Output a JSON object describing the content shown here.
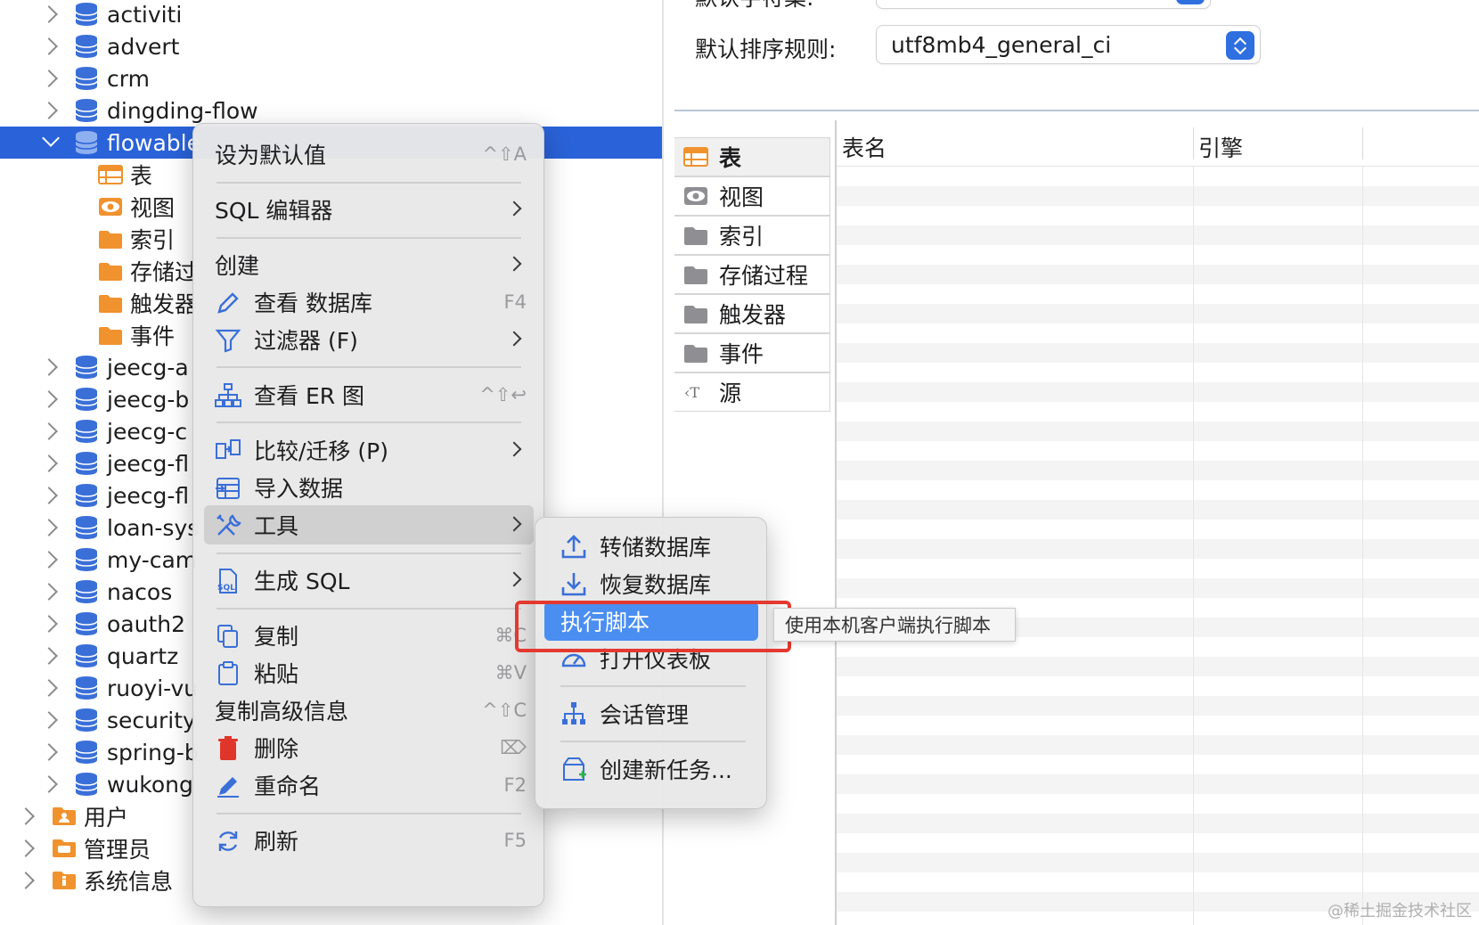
{
  "tree": {
    "databases_top": [
      "activiti",
      "advert",
      "crm",
      "dingding-flow"
    ],
    "selected": "flowable",
    "children": [
      "表",
      "视图",
      "索引",
      "存储过",
      "触发器",
      "事件"
    ],
    "databases_bottom": [
      "jeecg-a",
      "jeecg-b",
      "jeecg-c",
      "jeecg-fl",
      "jeecg-fl",
      "loan-sys",
      "my-cam",
      "nacos",
      "oauth2",
      "quartz",
      "ruoyi-vu",
      "security",
      "spring-b",
      "wukong"
    ],
    "root_items": [
      "用户",
      "管理员",
      "系统信息"
    ]
  },
  "form": {
    "charset_label": "默认字符集:",
    "collation_label": "默认排序规则:",
    "collation_value": "utf8mb4_general_ci"
  },
  "side_tabs": [
    "表",
    "视图",
    "索引",
    "存储过程",
    "触发器",
    "事件",
    "源"
  ],
  "grid": {
    "columns": [
      "表名",
      "引擎"
    ]
  },
  "menu": {
    "set_default": "设为默认值",
    "set_default_shortcut": "^⇧A",
    "sql_editor": "SQL 编辑器",
    "create": "创建",
    "view_db": "查看 数据库",
    "view_db_shortcut": "F4",
    "filter": "过滤器 (F)",
    "view_er": "查看 ER 图",
    "view_er_shortcut": "^⇧↩",
    "compare": "比较/迁移 (P)",
    "import": "导入数据",
    "tools": "工具",
    "gen_sql": "生成 SQL",
    "copy": "复制",
    "copy_shortcut": "⌘C",
    "paste": "粘贴",
    "paste_shortcut": "⌘V",
    "copy_adv": "复制高级信息",
    "copy_adv_shortcut": "^⇧C",
    "delete": "删除",
    "delete_shortcut": "⌦",
    "rename": "重命名",
    "rename_shortcut": "F2",
    "refresh": "刷新",
    "refresh_shortcut": "F5"
  },
  "submenu": {
    "dump": "转储数据库",
    "restore": "恢复数据库",
    "exec_script": "执行脚本",
    "dashboard": "打开仪表板",
    "session": "会话管理",
    "new_task": "创建新任务..."
  },
  "tooltip": "使用本机客户端执行脚本",
  "watermark": "@稀土掘金技术社区",
  "colors": {
    "selection": "#2a62d9",
    "submenu_active": "#4a8ef2",
    "highlight_box": "#e4392f",
    "db_icon": "#3a6fd8",
    "folder": "#f0922e"
  }
}
